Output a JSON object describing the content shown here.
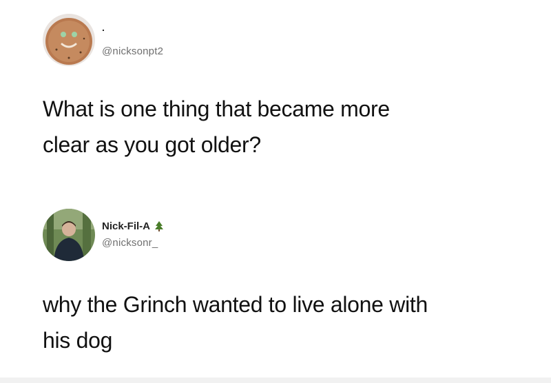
{
  "tweets": [
    {
      "display_name": ".",
      "handle": "@nicksonpt2",
      "text_lines": [
        "What is one thing that became more",
        "clear as you got older?"
      ],
      "avatar": "gingerbread-cookie-avatar"
    },
    {
      "display_name": "Nick-Fil-A",
      "name_emoji": "tree-icon",
      "handle": "@nicksonr_",
      "text_lines": [
        "why the Grinch wanted to live alone with",
        "his dog"
      ],
      "avatar": "person-photo-avatar"
    }
  ],
  "colors": {
    "background": "#ffffff",
    "text": "#111111",
    "handle": "#6f6f6f",
    "tree": "#4a7d2a"
  }
}
